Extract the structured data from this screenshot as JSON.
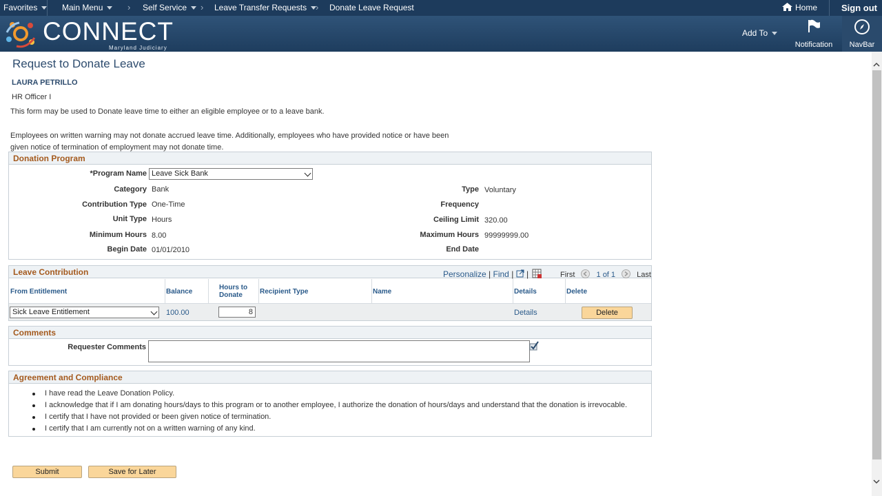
{
  "topnav": {
    "favorites": "Favorites",
    "main_menu": "Main Menu",
    "crumb1": "Self Service",
    "crumb2": "Leave Transfer Requests",
    "crumb3": "Donate Leave Request",
    "home": "Home",
    "sign_out": "Sign out"
  },
  "brand": {
    "name": "CONNECT",
    "sub": "Maryland Judiciary",
    "add_to": "Add To",
    "notification": "Notification",
    "navbar": "NavBar"
  },
  "page": {
    "title": "Request to Donate Leave",
    "employee_name": "LAURA PETRILLO",
    "employee_title": "HR Officer I",
    "intro1": "This form may be used to Donate leave time to either an eligible employee or to a leave bank.",
    "intro2": "Employees on written warning may not donate accrued leave time. Additionally, employees who have provided notice or have been given notice of termination of employment may not donate time."
  },
  "donation_program": {
    "header": "Donation Program",
    "program_name_label": "*Program Name",
    "program_name_value": "Leave Sick Bank",
    "category_label": "Category",
    "category_value": "Bank",
    "contribution_type_label": "Contribution Type",
    "contribution_type_value": "One-Time",
    "unit_type_label": "Unit Type",
    "unit_type_value": "Hours",
    "minimum_hours_label": "Minimum Hours",
    "minimum_hours_value": "8.00",
    "begin_date_label": "Begin Date",
    "begin_date_value": "01/01/2010",
    "type_label": "Type",
    "type_value": "Voluntary",
    "frequency_label": "Frequency",
    "ceiling_limit_label": "Ceiling Limit",
    "ceiling_limit_value": "320.00",
    "maximum_hours_label": "Maximum Hours",
    "maximum_hours_value": "99999999.00",
    "end_date_label": "End Date"
  },
  "leave_contribution": {
    "header": "Leave Contribution",
    "personalize": "Personalize",
    "find": "Find",
    "first": "First",
    "range": "1 of 1",
    "last": "Last",
    "columns": {
      "from_entitlement": "From Entitlement",
      "balance": "Balance",
      "hours_to_donate": "Hours to Donate",
      "recipient_type": "Recipient Type",
      "name": "Name",
      "details": "Details",
      "delete": "Delete"
    },
    "row": {
      "entitlement": "Sick Leave Entitlement",
      "balance": "100.00",
      "hours": "8",
      "details": "Details",
      "delete": "Delete"
    }
  },
  "comments": {
    "header": "Comments",
    "requester_label": "Requester Comments"
  },
  "agreement": {
    "header": "Agreement and Compliance",
    "items": [
      "I have read the Leave Donation Policy.",
      "I acknowledge that if I am donating hours/days to this program or to another employee, I authorize the donation of hours/days and understand that the donation is irrevocable.",
      "I certify that I have not provided or been given notice of termination.",
      "I certify that I am currently not on a written warning of any kind."
    ]
  },
  "actions": {
    "submit": "Submit",
    "save_later": "Save for Later"
  },
  "colors": {
    "nav_bg": "#1d3b5c",
    "section_header_text": "#a45a1e",
    "link": "#2a5a8a",
    "button_bg": "#fad69a"
  }
}
